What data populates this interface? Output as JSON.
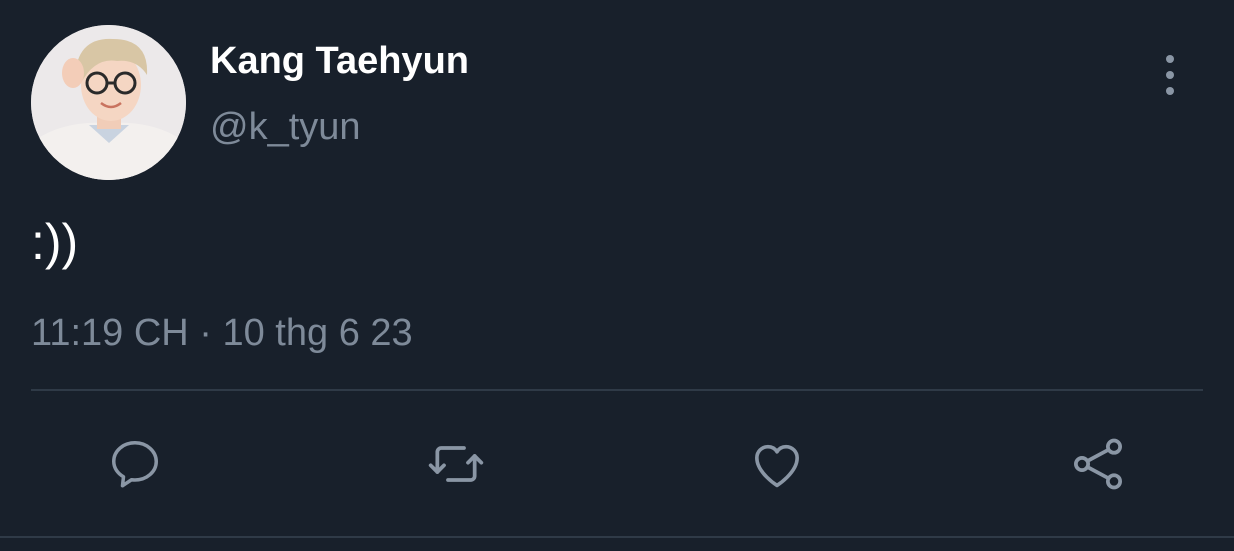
{
  "tweet": {
    "author": {
      "display_name": "Kang Taehyun",
      "handle": "@k_tyun",
      "avatar_icon": "profile-photo"
    },
    "text": ":))",
    "timestamp": "11:19 CH · 10 thg 6 23",
    "more_icon": "more-vertical-icon",
    "actions": [
      {
        "name": "reply",
        "icon": "reply-icon"
      },
      {
        "name": "retweet",
        "icon": "retweet-icon"
      },
      {
        "name": "like",
        "icon": "heart-icon"
      },
      {
        "name": "share",
        "icon": "share-icon"
      }
    ]
  },
  "colors": {
    "background": "#18202b",
    "primary_text": "#ffffff",
    "secondary_text": "#7e8a99",
    "icon": "#8a96a5",
    "divider": "#2f3a47"
  }
}
